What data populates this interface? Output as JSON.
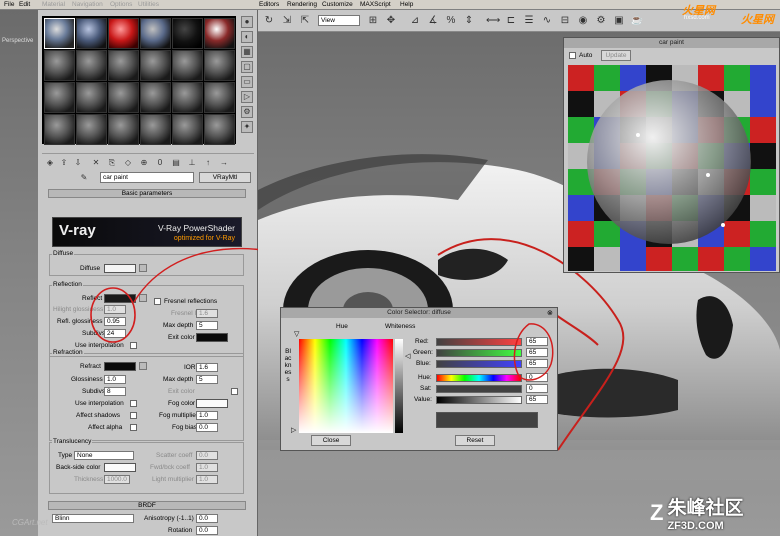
{
  "menubar": {
    "left_items": [
      "File",
      "Edit",
      "Material",
      "Navigation",
      "Options",
      "Utilities"
    ],
    "right_items": [
      "Editors",
      "Rendering",
      "Customize",
      "MAXScript",
      "Help"
    ]
  },
  "toolbar": {
    "view_select": "View"
  },
  "viewport": {
    "label": "Perspective"
  },
  "material_editor": {
    "material_name": "car paint",
    "material_type": "VRayMtl",
    "rollout_basic": "Basic parameters",
    "vray_logo": {
      "name": "V-ray",
      "headline": "V-Ray PowerShader",
      "subline": "optimized for V-Ray"
    },
    "diffuse": {
      "group": "Diffuse",
      "label": "Diffuse"
    },
    "reflection": {
      "group": "Reflection",
      "reflect": "Reflect",
      "hilight_glossiness": "Hilight glossiness",
      "hilight_value": "1.0",
      "refl_glossiness": "Refl. glossiness",
      "refl_value": "0.95",
      "subdivs": "Subdivs",
      "subdivs_value": "24",
      "use_interpolation": "Use interpolation",
      "fresnel": "Fresnel reflections",
      "fresnel_ior": "Fresnel IOR",
      "fresnel_ior_value": "1.6",
      "max_depth": "Max depth",
      "max_depth_value": "5",
      "exit_color": "Exit color"
    },
    "refraction": {
      "group": "Refraction",
      "refract": "Refract",
      "glossiness": "Glossiness",
      "glossiness_value": "1.0",
      "subdivs": "Subdivs",
      "subdivs_value": "8",
      "use_interpolation": "Use interpolation",
      "affect_shadows": "Affect shadows",
      "affect_alpha": "Affect alpha",
      "ior": "IOR",
      "ior_value": "1.6",
      "max_depth": "Max depth",
      "max_depth_value": "5",
      "exit_color": "Exit color",
      "fog_color": "Fog color",
      "fog_multiplier": "Fog multiplier",
      "fog_multiplier_value": "1.0",
      "fog_bias": "Fog bias",
      "fog_bias_value": "0.0"
    },
    "translucency": {
      "group": "Translucency",
      "type": "Type",
      "type_value": "None",
      "backside_color": "Back-side color",
      "thickness": "Thickness",
      "thickness_value": "1000.0",
      "scatter_coeff": "Scatter coeff",
      "scatter_value": "0.0",
      "fwd_bck_coeff": "Fwd/bck coeff",
      "fwd_bck_value": "1.0",
      "light_multiplier": "Light multiplier",
      "light_mult_value": "1.0"
    },
    "brdf": {
      "rollout": "BRDF",
      "type_value": "Blinn",
      "anisotropy": "Anisotropy (-1..1)",
      "anisotropy_value": "0.0",
      "rotation": "Rotation",
      "rotation_value": "0.0"
    }
  },
  "preview": {
    "title": "car paint",
    "auto_label": "Auto",
    "update_label": "Update",
    "checker_colors": [
      "#cc2222",
      "#22aa33",
      "#3344cc",
      "#111111",
      "#bbbbbb"
    ]
  },
  "color_selector": {
    "title": "Color Selector: diffuse",
    "hue_label": "Hue",
    "whiteness_label": "Whiteness",
    "blackness_label": "Blackness",
    "red_label": "Red:",
    "green_label": "Green:",
    "blue_label": "Blue:",
    "hue2_label": "Hue:",
    "sat_label": "Sat:",
    "value_label": "Value:",
    "red_value": "65",
    "green_value": "65",
    "blue_value": "65",
    "hue_value": "0",
    "sat_value": "0",
    "val_value": "65",
    "close_label": "Close",
    "reset_label": "Reset"
  },
  "watermarks": {
    "top_right": "火星网",
    "top_right_sub": "hxsd.com",
    "bottom_right_big": "朱峰社区",
    "bottom_right_small": "ZF3D.COM",
    "bottom_left": "CGArt.net"
  }
}
